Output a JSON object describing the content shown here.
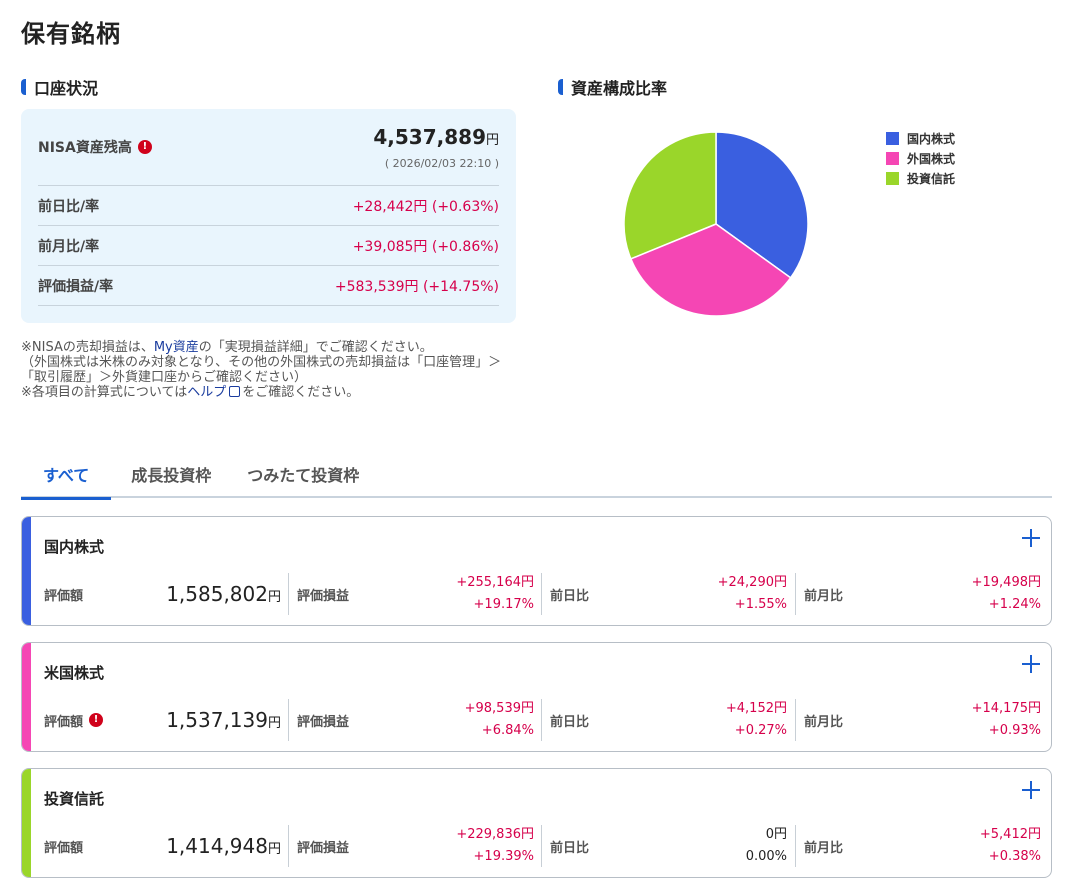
{
  "page": {
    "title": "保有銘柄"
  },
  "account": {
    "heading": "口座状況",
    "nisa_label": "NISA資産残高",
    "nisa_value": "4,537,889",
    "nisa_unit": "円",
    "timestamp": "( 2026/02/03 22:10 )",
    "rows": [
      {
        "label": "前日比/率",
        "value": "+28,442円 (+0.63%)"
      },
      {
        "label": "前月比/率",
        "value": "+39,085円 (+0.86%)"
      },
      {
        "label": "評価損益/率",
        "value": "+583,539円 (+14.75%)"
      }
    ]
  },
  "notes": {
    "line1_a": "※NISAの売却損益は、",
    "line1_link": "My資産",
    "line1_b": "の「実現損益詳細」でご確認ください。",
    "line2": "（外国株式は米株のみ対象となり、その他の外国株式の売却損益は「口座管理」＞「取引履歴」＞外貨建口座からご確認ください）",
    "line3_a": "※各項目の計算式については",
    "line3_link": "ヘルプ",
    "line3_b": "をご確認ください。"
  },
  "allocation": {
    "heading": "資産構成比率",
    "legend": [
      {
        "label": "国内株式",
        "color": "#3a5fe0"
      },
      {
        "label": "外国株式",
        "color": "#f546b4"
      },
      {
        "label": "投資信託",
        "color": "#9ad62a"
      }
    ]
  },
  "chart_data": {
    "type": "pie",
    "categories": [
      "国内株式",
      "外国株式",
      "投資信託"
    ],
    "values": [
      1585802,
      1537139,
      1414948
    ],
    "colors": [
      "#3a5fe0",
      "#f546b4",
      "#9ad62a"
    ],
    "legend_position": "right"
  },
  "tabs": [
    {
      "label": "すべて",
      "active": true
    },
    {
      "label": "成長投資枠",
      "active": false
    },
    {
      "label": "つみたて投資枠",
      "active": false
    }
  ],
  "cards": [
    {
      "title": "国内株式",
      "color": "#3a5fe0",
      "alert": false,
      "valuation_label": "評価額",
      "valuation": "1,585,802",
      "unit": "円",
      "pl_label": "評価損益",
      "pl_amount": "+255,164円",
      "pl_rate": "+19.17%",
      "day_label": "前日比",
      "day_amount": "+24,290円",
      "day_rate": "+1.55%",
      "month_label": "前月比",
      "month_amount": "+19,498円",
      "month_rate": "+1.24%"
    },
    {
      "title": "米国株式",
      "color": "#f546b4",
      "alert": true,
      "valuation_label": "評価額",
      "valuation": "1,537,139",
      "unit": "円",
      "pl_label": "評価損益",
      "pl_amount": "+98,539円",
      "pl_rate": "+6.84%",
      "day_label": "前日比",
      "day_amount": "+4,152円",
      "day_rate": "+0.27%",
      "month_label": "前月比",
      "month_amount": "+14,175円",
      "month_rate": "+0.93%"
    },
    {
      "title": "投資信託",
      "color": "#9ad62a",
      "alert": false,
      "valuation_label": "評価額",
      "valuation": "1,414,948",
      "unit": "円",
      "pl_label": "評価損益",
      "pl_amount": "+229,836円",
      "pl_rate": "+19.39%",
      "day_label": "前日比",
      "day_amount": "0円",
      "day_rate": "0.00%",
      "month_label": "前月比",
      "month_amount": "+5,412円",
      "month_rate": "+0.38%"
    }
  ]
}
